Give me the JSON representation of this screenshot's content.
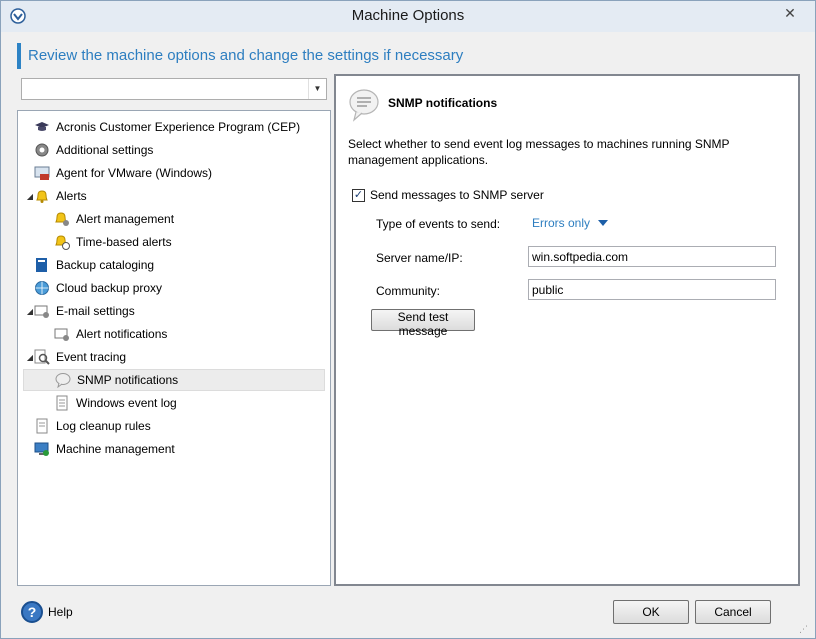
{
  "window": {
    "title": "Machine Options"
  },
  "header": {
    "instruction": "Review the machine options and change the settings if necessary"
  },
  "left": {
    "combo_value": "",
    "tree": [
      {
        "label": "Acronis Customer Experience Program (CEP)",
        "icon": "graduation-cap-icon",
        "level": 0,
        "expander": ""
      },
      {
        "label": "Additional settings",
        "icon": "settings-gear-icon",
        "level": 0,
        "expander": ""
      },
      {
        "label": "Agent for VMware (Windows)",
        "icon": "vmware-agent-icon",
        "level": 0,
        "expander": ""
      },
      {
        "label": "Alerts",
        "icon": "bell-icon",
        "level": 0,
        "expander": "◢"
      },
      {
        "label": "Alert management",
        "icon": "bell-settings-icon",
        "level": 1,
        "expander": ""
      },
      {
        "label": "Time-based alerts",
        "icon": "bell-clock-icon",
        "level": 1,
        "expander": ""
      },
      {
        "label": "Backup cataloging",
        "icon": "catalog-book-icon",
        "level": 0,
        "expander": ""
      },
      {
        "label": "Cloud backup proxy",
        "icon": "globe-icon",
        "level": 0,
        "expander": ""
      },
      {
        "label": "E-mail settings",
        "icon": "email-settings-icon",
        "level": 0,
        "expander": "◢"
      },
      {
        "label": "Alert notifications",
        "icon": "alert-email-icon",
        "level": 1,
        "expander": ""
      },
      {
        "label": "Event tracing",
        "icon": "magnifier-icon",
        "level": 0,
        "expander": "◢"
      },
      {
        "label": "SNMP notifications",
        "icon": "speech-bubble-icon",
        "level": 1,
        "expander": "",
        "selected": true
      },
      {
        "label": "Windows event log",
        "icon": "log-document-icon",
        "level": 1,
        "expander": ""
      },
      {
        "label": "Log cleanup rules",
        "icon": "log-cleanup-icon",
        "level": 0,
        "expander": ""
      },
      {
        "label": "Machine management",
        "icon": "machine-icon",
        "level": 0,
        "expander": ""
      }
    ]
  },
  "right": {
    "title": "SNMP notifications",
    "description": "Select whether to send event log messages to machines running SNMP management applications.",
    "send_checkbox_label": "Send messages to SNMP server",
    "send_checked": true,
    "events_label": "Type of events to send:",
    "events_value": "Errors only",
    "server_label": "Server name/IP:",
    "server_value": "win.softpedia.com",
    "community_label": "Community:",
    "community_value": "public",
    "send_test_label": "Send test message"
  },
  "footer": {
    "help_label": "Help",
    "ok_label": "OK",
    "cancel_label": "Cancel"
  },
  "colors": {
    "accent": "#2d7ec0",
    "selection": "#ececec"
  }
}
